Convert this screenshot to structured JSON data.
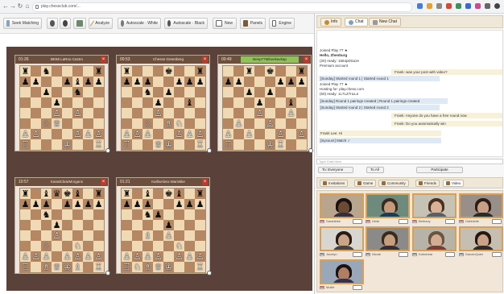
{
  "browser": {
    "url": "play.chessclub.com/...",
    "nav": [
      "←",
      "→",
      "↻",
      "⌂"
    ]
  },
  "toolbar": {
    "buttons": [
      {
        "label": "Seek Matching",
        "icon": "seek-icon"
      },
      {
        "label": "",
        "icon": "record-icon"
      },
      {
        "label": "",
        "icon": "stop-icon"
      },
      {
        "label": "",
        "icon": "person-icon"
      },
      {
        "label": "Analyze",
        "icon": "pen-icon"
      },
      {
        "label": "Autoscale · White",
        "icon": "autoscale-white-icon"
      },
      {
        "label": "Autoscale · Black",
        "icon": "autoscale-black-icon"
      },
      {
        "label": "New",
        "icon": "window-icon"
      },
      {
        "label": "Panels",
        "icon": "panels-icon"
      },
      {
        "label": "Engine",
        "icon": "engine-icon"
      }
    ]
  },
  "boards": [
    {
      "clock": "01:26",
      "name": "BK55 LaRoo Castro",
      "highlight": false,
      "position": [
        "♜ ♞    ♜",
        "♟♟  ♟♝♟♟",
        "  ♟  ♞  ",
        "   ♟    ",
        "   ♙ ♙  ",
        "  ♘♕    ",
        "♙♙   ♙♙♙",
        "♖   ♔  ♖"
      ]
    },
    {
      "clock": "00:53",
      "name": "Chesse Greenberg",
      "highlight": false,
      "position": [
        "♜   ♚  ♜",
        "♟♟♟  ♟♟♟",
        "  ♞ ♟   ",
        "   ♟  ♝ ",
        "   ♙    ",
        "  ♘ ♗♘  ",
        "♙♙♙  ♙♙♙",
        "♖  ♕♔  ♖"
      ]
    },
    {
      "clock": "00:49",
      "name": "Beep77Mikeekavkap",
      "highlight": true,
      "position": [
        "  ♜ ♚  ♜",
        "♟♟   ♟♟♟",
        "  ♟ ♟   ",
        "   ♟  ♝ ",
        "   ♙  ♙ ",
        " ♙  ♙   ",
        "♙ ♙  ♙ ♙",
        "♖   ♔♖  "
      ]
    },
    {
      "clock": "10:57",
      "name": "KanatClearMorgans",
      "highlight": false,
      "position": [
        "♜ ♝♛♚♝ ♜",
        "♟♟♟ ♟♟♟♟",
        "  ♞     ",
        "   ♟    ",
        "   ♙    ",
        "  ♘  ♘  ",
        "♙♙♙ ♙♙♙♙",
        "♖ ♗♕♔♗ ♖"
      ]
    },
    {
      "clock": "01:21",
      "name": "KarllaAlexx Mariskke",
      "highlight": false,
      "position": [
        "♜ ♝ ♚♝ ♜",
        "♟♟♟  ♟♟♟",
        "  ♞♟    ",
        "    ♟   ",
        "  ♗ ♙   ",
        "     ♘  ",
        "♙♙♙♙ ♙♙♙",
        "♖♘♗♕♔  ♖"
      ]
    }
  ],
  "chat": {
    "tabs": [
      {
        "label": "Info",
        "active": false
      },
      {
        "label": "Chat",
        "active": true
      },
      {
        "label": "New Chat",
        "active": false
      }
    ],
    "plain_lines": [
      "Joined Play 77 ★",
      "Hello, Zhenburg",
      "(20) ready: 1664pDSuze",
      "Premium account",
      "Joined Play 77 ★",
      "Hosting for: play.chess.com",
      "(60) ready: 1L7LZ7nLLe"
    ],
    "highlights": [
      {
        "text": "Frank: was your post with video?",
        "side": "right",
        "yellow": true
      },
      {
        "text": "[Sunday] Started round 1   |  Started round 1",
        "side": "left",
        "yellow": false
      },
      {
        "text": "[Sunday] Round 1 pairings created  |  Round 1 pairings created",
        "side": "left",
        "yellow": false
      },
      {
        "text": "[Sunday] Started round 2   |  Started round 2",
        "side": "left",
        "yellow": false
      },
      {
        "text": "Frank: Anyone do you have a free round now",
        "side": "right",
        "yellow": true
      },
      {
        "text": "Frank: Do you automatically win",
        "side": "right",
        "yellow": true
      },
      {
        "text": "Frank Lee: Hi",
        "side": "left",
        "yellow": true
      },
      {
        "text": "[Sysouvr] Match ✓",
        "side": "left",
        "yellow": false
      }
    ],
    "input_placeholder": "Type Chat Here",
    "tools": {
      "left": "To: Everyone",
      "mid": "To All",
      "right": "Participate"
    }
  },
  "bottom_tabs": [
    {
      "label": "Invitations",
      "active": false
    },
    {
      "label": "Game",
      "active": false
    },
    {
      "label": "Community",
      "active": false
    },
    {
      "label": "Friends",
      "active": false
    },
    {
      "label": "Video",
      "active": true
    }
  ],
  "videos": [
    {
      "name": "Sarahklee",
      "bg": "#b9a58e",
      "skin": "#6b4a36",
      "hair": "#1a1210",
      "shirt": "#3a2d3a"
    },
    {
      "name": "Heidi",
      "bg": "#6e8a7c",
      "skin": "#c49a7a",
      "hair": "#3a2a1f",
      "shirt": "#1d3b55"
    },
    {
      "name": "Bethany",
      "bg": "#c7c2b6",
      "skin": "#d8b196",
      "hair": "#4a3020",
      "shirt": "#5a5f66"
    },
    {
      "name": "Gabbielle",
      "bg": "#9a8f88",
      "skin": "#caa084",
      "hair": "#2b1e16",
      "shirt": "#2a2a2a"
    },
    {
      "name": "Jocelyn",
      "bg": "#d9d6d2",
      "skin": "#c9a487",
      "hair": "#2a1b12",
      "shirt": "#444"
    },
    {
      "name": "Nicole",
      "bg": "#8b8a89",
      "skin": "#c59d7f",
      "hair": "#3a2a1c",
      "shirt": "#2f2f3a"
    },
    {
      "name": "Kahnbear",
      "bg": "#b7b3a8",
      "skin": "#d3ad93",
      "hair": "#6b5440",
      "shirt": "#7a3c3c"
    },
    {
      "name": "DancinQueen",
      "bg": "#c6bfb1",
      "skin": "#caa187",
      "hair": "#24180f",
      "shirt": "#2b2b2b"
    },
    {
      "name": "Mollie",
      "bg": "#9aa7b8",
      "skin": "#b07f63",
      "hair": "#1a1310",
      "shirt": "#3c3048"
    }
  ]
}
